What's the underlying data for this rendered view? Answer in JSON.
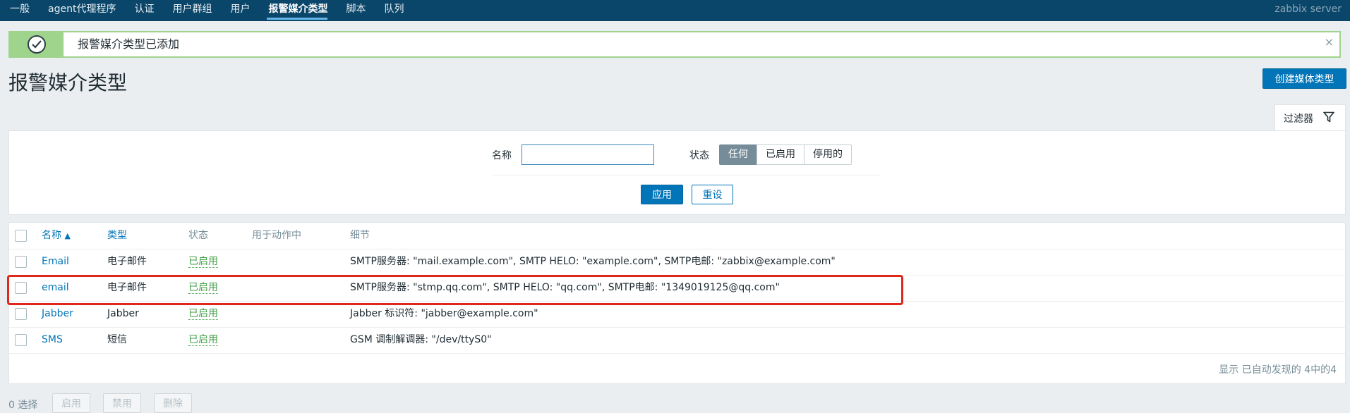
{
  "nav": {
    "items": [
      "一般",
      "agent代理程序",
      "认证",
      "用户群组",
      "用户",
      "报警媒介类型",
      "脚本",
      "队列"
    ],
    "active_index": 5,
    "server_label": "zabbix server"
  },
  "message": {
    "text": "报警媒介类型已添加",
    "close": "×",
    "type": "success"
  },
  "page": {
    "title": "报警媒介类型",
    "create_button": "创建媒体类型"
  },
  "filter": {
    "tab_label": "过滤器",
    "name_label": "名称",
    "name_value": "",
    "status_label": "状态",
    "status_options": [
      "任何",
      "已启用",
      "停用的"
    ],
    "status_selected": "任何",
    "apply": "应用",
    "reset": "重设"
  },
  "table": {
    "headers": {
      "name": "名称",
      "sort_arrow": "▲",
      "type": "类型",
      "status": "状态",
      "used_in_actions": "用于动作中",
      "details": "细节"
    },
    "rows": [
      {
        "name": "Email",
        "type": "电子邮件",
        "status": "已启用",
        "used_in_actions": "",
        "details": "SMTP服务器: \"mail.example.com\", SMTP HELO: \"example.com\", SMTP电邮: \"zabbix@example.com\""
      },
      {
        "name": "email",
        "type": "电子邮件",
        "status": "已启用",
        "used_in_actions": "",
        "details": "SMTP服务器: \"stmp.qq.com\", SMTP HELO: \"qq.com\", SMTP电邮: \"1349019125@qq.com\""
      },
      {
        "name": "Jabber",
        "type": "Jabber",
        "status": "已启用",
        "used_in_actions": "",
        "details": "Jabber 标识符: \"jabber@example.com\""
      },
      {
        "name": "SMS",
        "type": "短信",
        "status": "已启用",
        "used_in_actions": "",
        "details": "GSM 调制解调器: \"/dev/ttyS0\""
      }
    ],
    "highlighted_row": 1,
    "footer": "显示 已自动发现的 4中的4"
  },
  "bottom": {
    "selected": "0 选择",
    "enable": "启用",
    "disable": "禁用",
    "delete": "删除"
  },
  "colors": {
    "nav_bg": "#0a466a",
    "primary": "#0275b8",
    "success": "#429e47",
    "highlight": "#e0271b"
  }
}
